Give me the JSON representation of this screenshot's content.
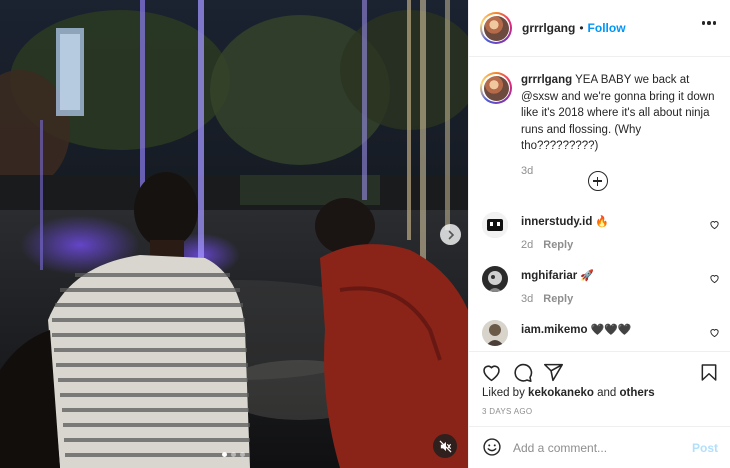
{
  "header": {
    "username": "grrrlgang",
    "separator": "•",
    "follow_label": "Follow"
  },
  "caption": {
    "username": "grrrlgang",
    "text": "YEA BABY we back at @sxsw and we're gonna bring it down like it's 2018 where it's all about ninja runs and flossing. (Why tho?????????)",
    "time": "3d"
  },
  "comments": [
    {
      "username": "innerstudy.id",
      "emoji": "🔥",
      "time": "2d",
      "reply_label": "Reply"
    },
    {
      "username": "mghifariar",
      "emoji": "🚀",
      "time": "3d",
      "reply_label": "Reply"
    },
    {
      "username": "iam.mikemo",
      "emoji": "🖤🖤🖤",
      "time": "",
      "reply_label": ""
    }
  ],
  "likes": {
    "prefix": "Liked by",
    "user": "kekokaneko",
    "conjunction": "and",
    "others": "others"
  },
  "timeago": "3 DAYS AGO",
  "add_comment": {
    "placeholder": "Add a comment...",
    "post_label": "Post"
  },
  "media": {
    "slide_count": 3,
    "active_slide": 1
  },
  "colors": {
    "link": "#0095f6",
    "post_disabled": "#b2dffc",
    "muted_text": "#8e8e8e"
  }
}
